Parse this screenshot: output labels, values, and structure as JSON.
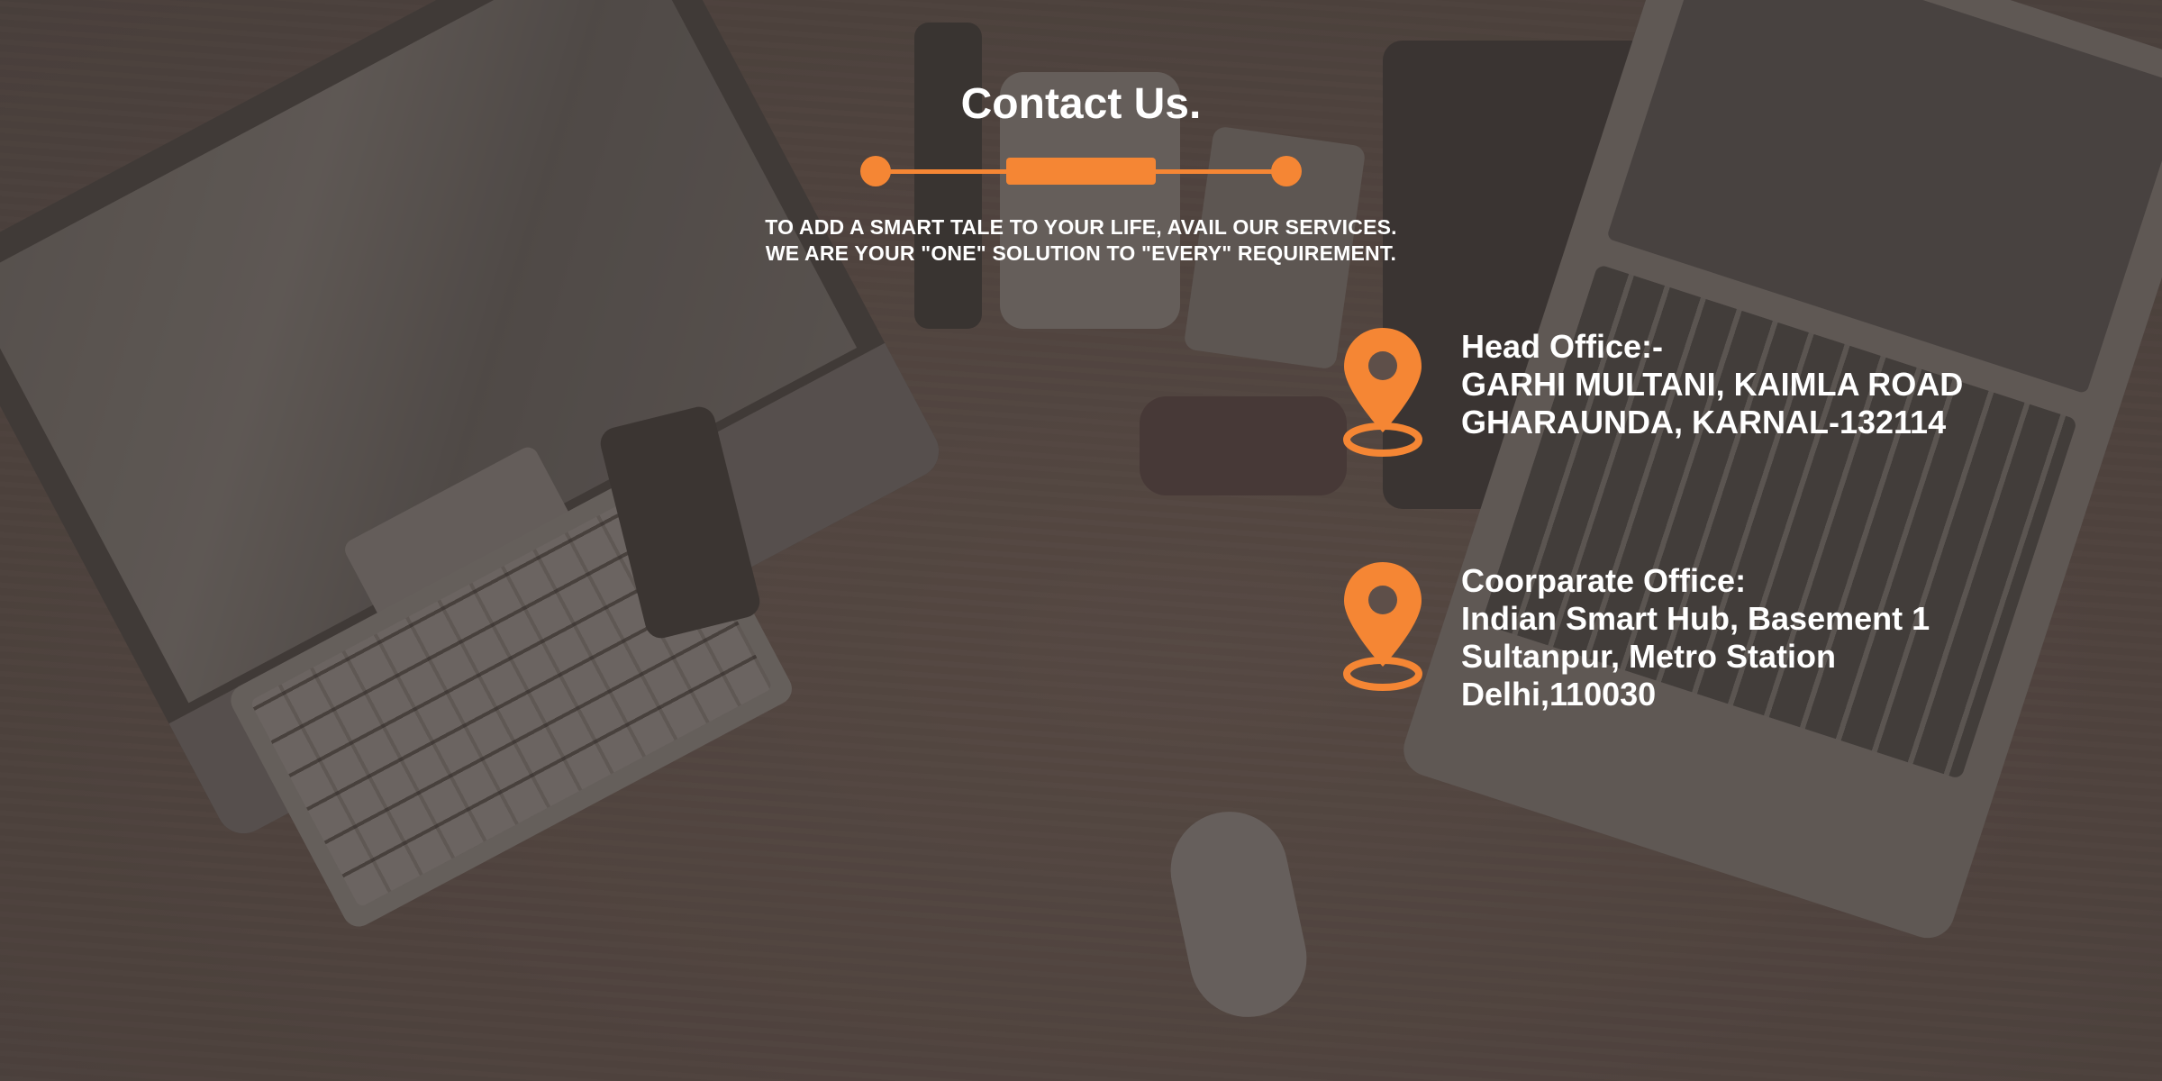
{
  "page": {
    "title": "Contact Us.",
    "tagline": [
      "TO ADD A SMART TALE TO YOUR LIFE, AVAIL OUR SERVICES.",
      "WE ARE YOUR \"ONE\" SOLUTION TO \"EVERY\" REQUIREMENT."
    ]
  },
  "offices": [
    {
      "heading": "Head Office:-",
      "lines": [
        "GARHI MULTANI, KAIMLA ROAD",
        "GHARAUNDA, KARNAL-132114"
      ],
      "icon": "location-pin-icon"
    },
    {
      "heading": "Coorparate Office:",
      "lines": [
        "Indian Smart Hub, Basement 1",
        "Sultanpur, Metro Station",
        "Delhi,110030"
      ],
      "icon": "location-pin-icon"
    }
  ],
  "colors": {
    "accent": "#f58634",
    "text": "#ffffff",
    "overlay": "rgba(70,60,56,0.55)"
  }
}
